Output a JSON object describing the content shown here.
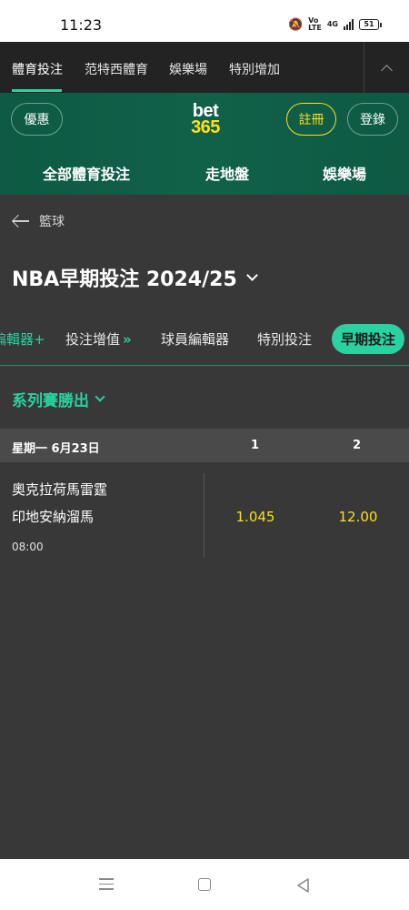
{
  "status_bar": {
    "time": "11:23",
    "net_top": "Vo",
    "net_bottom": "LTE",
    "net_gen": "4G",
    "battery": "51"
  },
  "top_nav": {
    "tabs": [
      "體育投注",
      "范特西體育",
      "娛樂場",
      "特別增加"
    ]
  },
  "header": {
    "promo_label": "優惠",
    "logo_top": "bet",
    "logo_bottom": "365",
    "register_label": "註冊",
    "login_label": "登錄",
    "main_nav": [
      "全部體育投注",
      "走地盤",
      "娛樂場"
    ]
  },
  "breadcrumb": {
    "back_label": "籃球"
  },
  "page": {
    "title": "NBA早期投注 2024/25"
  },
  "subtabs": {
    "items": [
      "編輯器+",
      "投注增值",
      "球員編輯器",
      "特別投注"
    ],
    "boost_arrows": "»",
    "active": "早期投注"
  },
  "market": {
    "title": "系列賽勝出",
    "date": "星期一 6月23日",
    "col1": "1",
    "col2": "2",
    "match": {
      "team1": "奧克拉荷馬雷霆",
      "team2": "印地安納溜馬",
      "time": "08:00",
      "odds1": "1.045",
      "odds2": "12.00"
    }
  },
  "colors": {
    "accent": "#2ad1a1",
    "brand_yellow": "#ffdf1b",
    "header_green": "#116149",
    "background": "#383838"
  }
}
